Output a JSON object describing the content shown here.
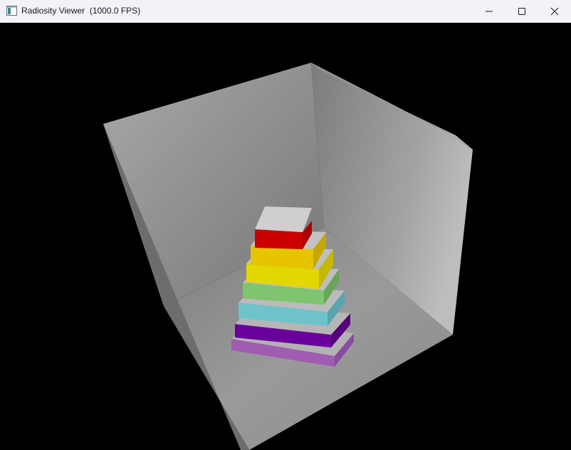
{
  "window": {
    "title": "Radiosity Viewer  (1000.0 FPS)",
    "icon": "app-window-icon",
    "controls": {
      "minimize": "minimize-icon",
      "maximize": "maximize-icon",
      "close": "close-icon"
    }
  },
  "scene": {
    "description_colors": {
      "background": "#000000",
      "walls": "#a0a0a0",
      "block_top": "#b8b8b8",
      "layers": [
        "#cc0000",
        "#e6c400",
        "#e0d800",
        "#7fc46f",
        "#6fc2cc",
        "#6a009c",
        "#a05cb0"
      ]
    }
  }
}
